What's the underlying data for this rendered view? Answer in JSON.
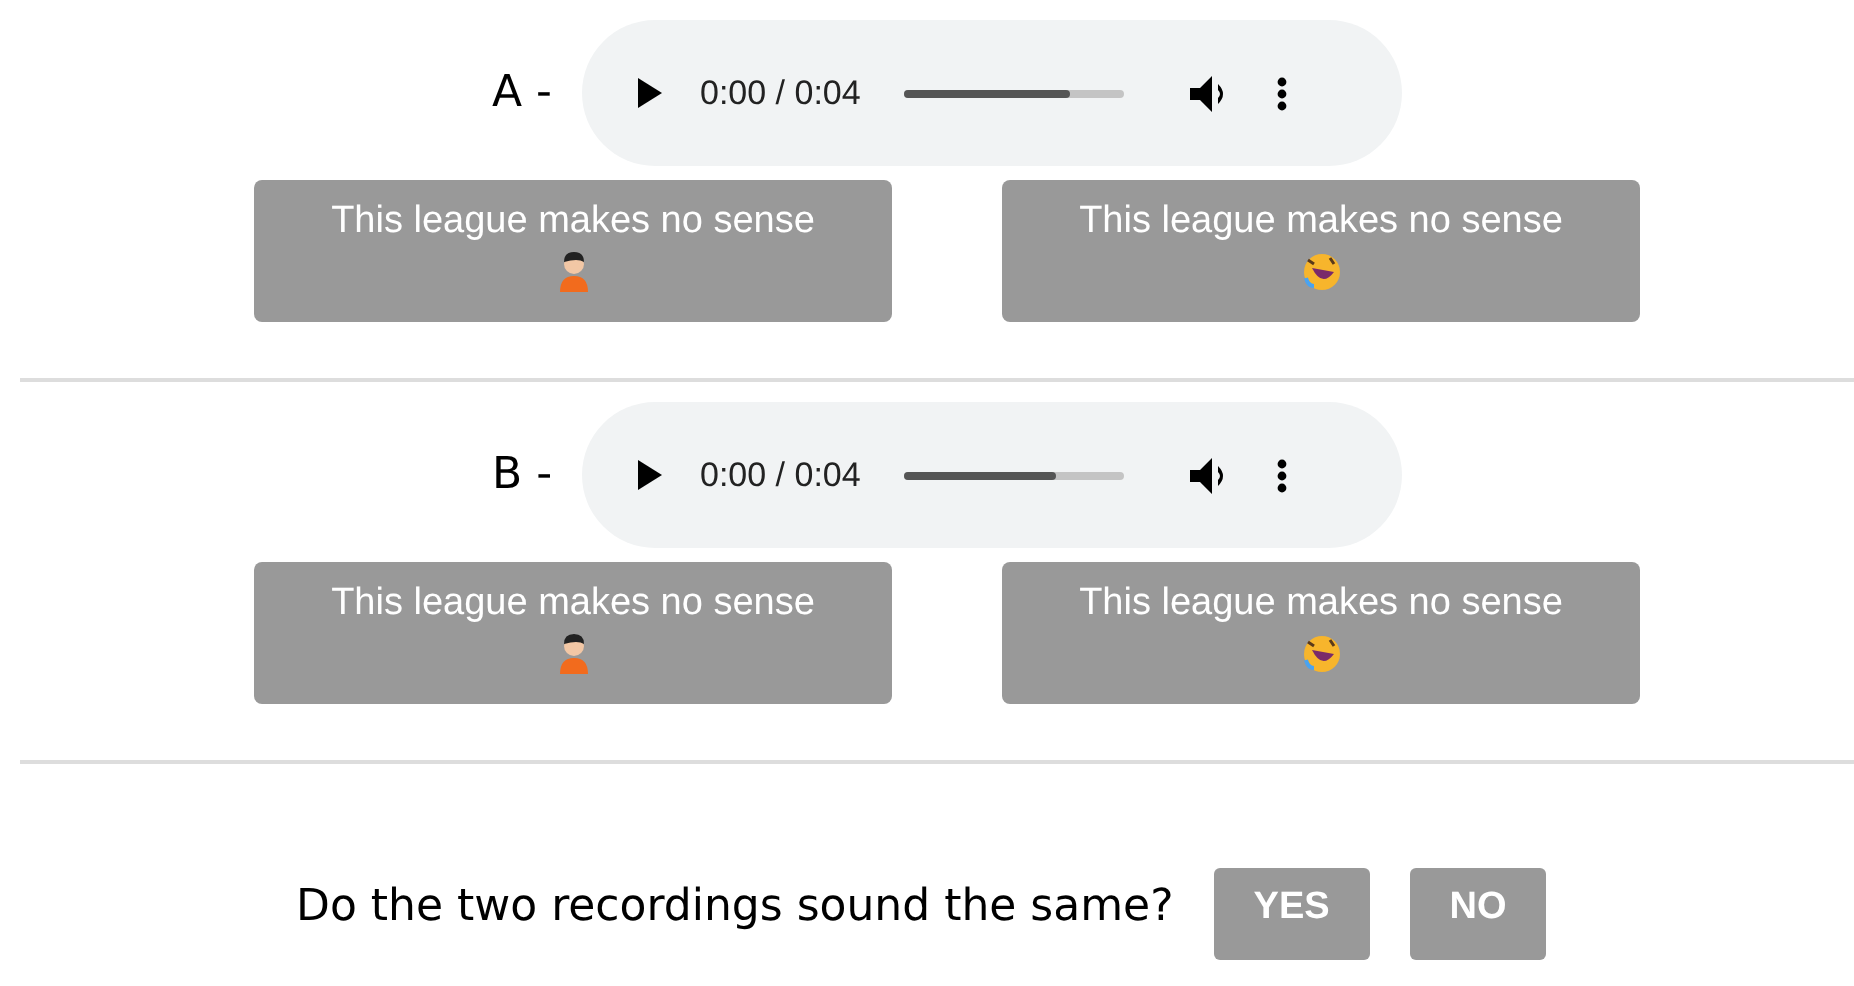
{
  "sections": [
    {
      "label": "A -",
      "player": {
        "time": "0:00 / 0:04",
        "level": 0.75
      },
      "choices": [
        "This league makes no sense",
        "This league makes no sense"
      ]
    },
    {
      "label": "B -",
      "player": {
        "time": "0:00 / 0:04",
        "level": 0.69
      },
      "choices": [
        "This league makes no sense",
        "This league makes no sense"
      ]
    }
  ],
  "question": {
    "text": "Do the two recordings sound the same?",
    "buttons": [
      "YES",
      "NO"
    ]
  }
}
